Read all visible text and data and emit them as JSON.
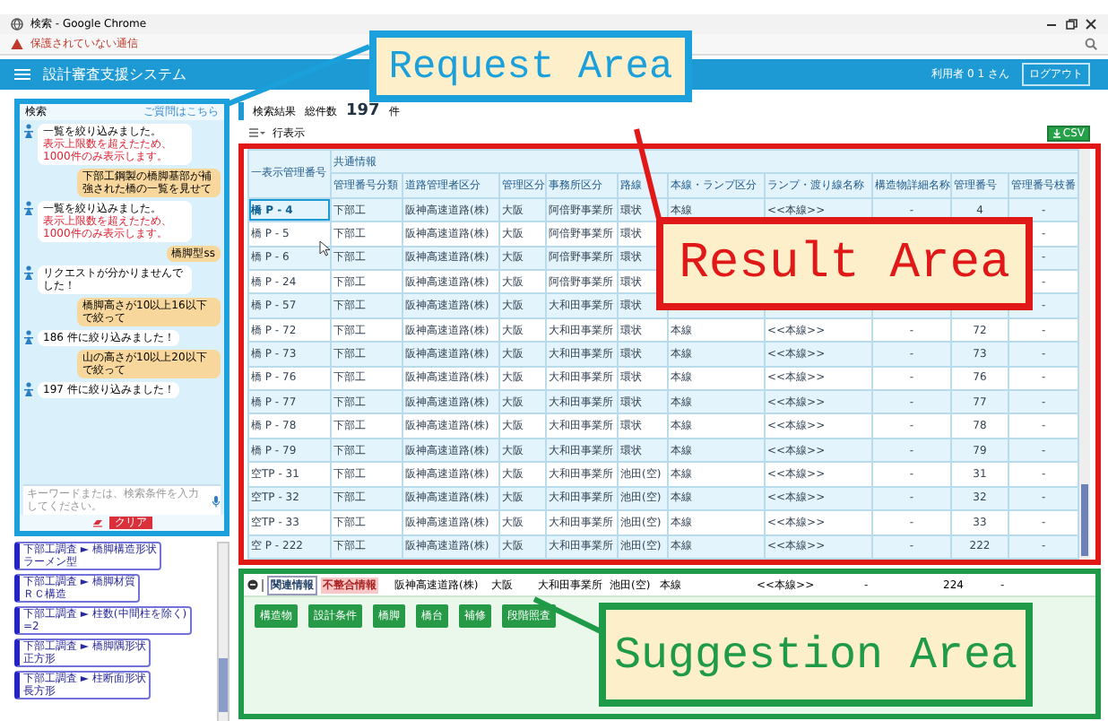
{
  "browser": {
    "title": "検索 - Google Chrome",
    "security_warning": "保護されていない通信"
  },
  "header": {
    "title": "設計審査支援システム",
    "user": "利用者 0 1 さん",
    "logout_button": "ログアウト"
  },
  "chat": {
    "title": "検索",
    "help_link": "ご質問はこちら",
    "messages": [
      {
        "kind": "bot",
        "text": "一覧を絞り込みました。",
        "warning": "表示上限数を超えたため、1000件のみ表示します。"
      },
      {
        "kind": "user",
        "text": "下部工鋼製の橋脚基部が補強された橋の一覧を見せて"
      },
      {
        "kind": "bot",
        "text": "一覧を絞り込みました。",
        "warning": "表示上限数を超えたため、1000件のみ表示します。"
      },
      {
        "kind": "user",
        "text": "橋脚型ss"
      },
      {
        "kind": "bot",
        "text": "リクエストが分かりませんでした！"
      },
      {
        "kind": "user",
        "text": "橋脚高さが10以上16以下で絞って"
      },
      {
        "kind": "bot",
        "text": "186 件に絞り込みました！"
      },
      {
        "kind": "user",
        "text": "山の高さが10以上20以下で絞って"
      },
      {
        "kind": "bot",
        "text": "197 件に絞り込みました！"
      }
    ],
    "input": {
      "placeholder": "キーワードまたは、検索条件を入力してください。"
    },
    "clear_button": "クリア"
  },
  "conditions": [
    {
      "field": "下部工調査 ► 橋脚構造形状",
      "value": "ラーメン型"
    },
    {
      "field": "下部工調査 ► 橋脚材質",
      "value": "ＲＣ構造"
    },
    {
      "field": "下部工調査 ► 柱数(中間柱を除く)",
      "value": "=2"
    },
    {
      "field": "下部工調査 ► 橋脚隅形状",
      "value": "正方形"
    },
    {
      "field": "下部工調査 ► 柱断面形状",
      "value": "長方形"
    }
  ],
  "results": {
    "title": "検索結果",
    "count_label": "総件数",
    "count": "197",
    "count_unit": "件",
    "rows_label": "行表示",
    "csv_button": "CSV",
    "table": {
      "group_header": "共通情報",
      "columns": [
        "一表示管理番号",
        "管理番号分類",
        "道路管理者区分",
        "管理区分",
        "事務所区分",
        "路線",
        "本線・ランプ区分",
        "ランプ・渡り線名称",
        "構造物詳細名称",
        "管理番号",
        "管理番号枝番"
      ],
      "rows": [
        {
          "selected": true,
          "cells": [
            "橋 P - 4",
            "下部工",
            "阪神高速道路(株)",
            "大阪",
            "阿倍野事業所",
            "環状",
            "本線",
            "<<本線>>",
            "-",
            "4",
            "-"
          ]
        },
        {
          "selected": false,
          "cells": [
            "橋 P - 5",
            "下部工",
            "阪神高速道路(株)",
            "大阪",
            "阿倍野事業所",
            "環状",
            null,
            null,
            null,
            null,
            "-"
          ]
        },
        {
          "selected": false,
          "cells": [
            "橋 P - 6",
            "下部工",
            "阪神高速道路(株)",
            "大阪",
            "阿倍野事業所",
            "環状",
            null,
            null,
            null,
            null,
            "-"
          ]
        },
        {
          "selected": false,
          "cells": [
            "橋 P - 24",
            "下部工",
            "阪神高速道路(株)",
            "大阪",
            "阿倍野事業所",
            "環状",
            null,
            null,
            null,
            null,
            "-"
          ]
        },
        {
          "selected": false,
          "cells": [
            "橋 P - 57",
            "下部工",
            "阪神高速道路(株)",
            "大阪",
            "大和田事業所",
            "環状",
            null,
            null,
            null,
            null,
            "-"
          ]
        },
        {
          "selected": false,
          "cells": [
            "橋 P - 72",
            "下部工",
            "阪神高速道路(株)",
            "大阪",
            "大和田事業所",
            "環状",
            "本線",
            "<<本線>>",
            "-",
            "72",
            "-"
          ]
        },
        {
          "selected": false,
          "cells": [
            "橋 P - 73",
            "下部工",
            "阪神高速道路(株)",
            "大阪",
            "大和田事業所",
            "環状",
            "本線",
            "<<本線>>",
            "-",
            "73",
            "-"
          ]
        },
        {
          "selected": false,
          "cells": [
            "橋 P - 76",
            "下部工",
            "阪神高速道路(株)",
            "大阪",
            "大和田事業所",
            "環状",
            "本線",
            "<<本線>>",
            "-",
            "76",
            "-"
          ]
        },
        {
          "selected": false,
          "cells": [
            "橋 P - 77",
            "下部工",
            "阪神高速道路(株)",
            "大阪",
            "大和田事業所",
            "環状",
            "本線",
            "<<本線>>",
            "-",
            "77",
            "-"
          ]
        },
        {
          "selected": false,
          "cells": [
            "橋 P - 78",
            "下部工",
            "阪神高速道路(株)",
            "大阪",
            "大和田事業所",
            "環状",
            "本線",
            "<<本線>>",
            "-",
            "78",
            "-"
          ]
        },
        {
          "selected": false,
          "cells": [
            "橋 P - 79",
            "下部工",
            "阪神高速道路(株)",
            "大阪",
            "大和田事業所",
            "環状",
            "本線",
            "<<本線>>",
            "-",
            "79",
            "-"
          ]
        },
        {
          "selected": false,
          "cells": [
            "空TP - 31",
            "下部工",
            "阪神高速道路(株)",
            "大阪",
            "大和田事業所",
            "池田(空)",
            "本線",
            "<<本線>>",
            "-",
            "31",
            "-"
          ]
        },
        {
          "selected": false,
          "cells": [
            "空TP - 32",
            "下部工",
            "阪神高速道路(株)",
            "大阪",
            "大和田事業所",
            "池田(空)",
            "本線",
            "<<本線>>",
            "-",
            "32",
            "-"
          ]
        },
        {
          "selected": false,
          "cells": [
            "空TP - 33",
            "下部工",
            "阪神高速道路(株)",
            "大阪",
            "大和田事業所",
            "池田(空)",
            "本線",
            "<<本線>>",
            "-",
            "33",
            "-"
          ]
        },
        {
          "selected": false,
          "cells": [
            "空 P - 222",
            "下部工",
            "阪神高速道路(株)",
            "大阪",
            "大和田事業所",
            "池田(空)",
            "本線",
            "<<本線>>",
            "-",
            "222",
            "-"
          ]
        }
      ]
    }
  },
  "suggestions": {
    "tabs": [
      {
        "label": "関連情報",
        "selected": true
      },
      {
        "label": "不整合情報",
        "selected": false
      }
    ],
    "row_cells": [
      "阪神高速道路(株)",
      "大阪",
      "大和田事業所",
      "池田(空)",
      "本線",
      "<<本線>>",
      "-",
      "224",
      "-"
    ],
    "buttons": [
      "構造物",
      "設計条件",
      "橋脚",
      "橋台",
      "補修",
      "段階照査"
    ]
  },
  "annotations": [
    {
      "kind": "request",
      "label": "Request Area",
      "color": "#1ba0dc"
    },
    {
      "kind": "result",
      "label": "Result Area",
      "color": "#e01818"
    },
    {
      "kind": "suggestion",
      "label": "Suggestion Area",
      "color": "#1f9a48"
    }
  ]
}
